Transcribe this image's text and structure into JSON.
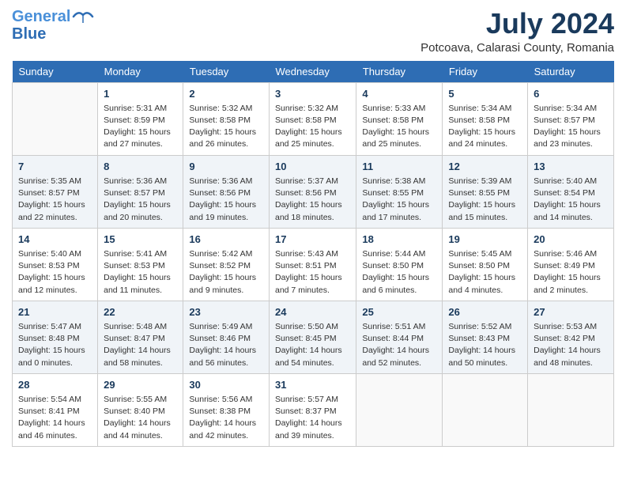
{
  "header": {
    "logo_line1": "General",
    "logo_line2": "Blue",
    "month_year": "July 2024",
    "location": "Potcoava, Calarasi County, Romania"
  },
  "days_of_week": [
    "Sunday",
    "Monday",
    "Tuesday",
    "Wednesday",
    "Thursday",
    "Friday",
    "Saturday"
  ],
  "weeks": [
    [
      {
        "day": "",
        "info": ""
      },
      {
        "day": "1",
        "info": "Sunrise: 5:31 AM\nSunset: 8:59 PM\nDaylight: 15 hours\nand 27 minutes."
      },
      {
        "day": "2",
        "info": "Sunrise: 5:32 AM\nSunset: 8:58 PM\nDaylight: 15 hours\nand 26 minutes."
      },
      {
        "day": "3",
        "info": "Sunrise: 5:32 AM\nSunset: 8:58 PM\nDaylight: 15 hours\nand 25 minutes."
      },
      {
        "day": "4",
        "info": "Sunrise: 5:33 AM\nSunset: 8:58 PM\nDaylight: 15 hours\nand 25 minutes."
      },
      {
        "day": "5",
        "info": "Sunrise: 5:34 AM\nSunset: 8:58 PM\nDaylight: 15 hours\nand 24 minutes."
      },
      {
        "day": "6",
        "info": "Sunrise: 5:34 AM\nSunset: 8:57 PM\nDaylight: 15 hours\nand 23 minutes."
      }
    ],
    [
      {
        "day": "7",
        "info": "Sunrise: 5:35 AM\nSunset: 8:57 PM\nDaylight: 15 hours\nand 22 minutes."
      },
      {
        "day": "8",
        "info": "Sunrise: 5:36 AM\nSunset: 8:57 PM\nDaylight: 15 hours\nand 20 minutes."
      },
      {
        "day": "9",
        "info": "Sunrise: 5:36 AM\nSunset: 8:56 PM\nDaylight: 15 hours\nand 19 minutes."
      },
      {
        "day": "10",
        "info": "Sunrise: 5:37 AM\nSunset: 8:56 PM\nDaylight: 15 hours\nand 18 minutes."
      },
      {
        "day": "11",
        "info": "Sunrise: 5:38 AM\nSunset: 8:55 PM\nDaylight: 15 hours\nand 17 minutes."
      },
      {
        "day": "12",
        "info": "Sunrise: 5:39 AM\nSunset: 8:55 PM\nDaylight: 15 hours\nand 15 minutes."
      },
      {
        "day": "13",
        "info": "Sunrise: 5:40 AM\nSunset: 8:54 PM\nDaylight: 15 hours\nand 14 minutes."
      }
    ],
    [
      {
        "day": "14",
        "info": "Sunrise: 5:40 AM\nSunset: 8:53 PM\nDaylight: 15 hours\nand 12 minutes."
      },
      {
        "day": "15",
        "info": "Sunrise: 5:41 AM\nSunset: 8:53 PM\nDaylight: 15 hours\nand 11 minutes."
      },
      {
        "day": "16",
        "info": "Sunrise: 5:42 AM\nSunset: 8:52 PM\nDaylight: 15 hours\nand 9 minutes."
      },
      {
        "day": "17",
        "info": "Sunrise: 5:43 AM\nSunset: 8:51 PM\nDaylight: 15 hours\nand 7 minutes."
      },
      {
        "day": "18",
        "info": "Sunrise: 5:44 AM\nSunset: 8:50 PM\nDaylight: 15 hours\nand 6 minutes."
      },
      {
        "day": "19",
        "info": "Sunrise: 5:45 AM\nSunset: 8:50 PM\nDaylight: 15 hours\nand 4 minutes."
      },
      {
        "day": "20",
        "info": "Sunrise: 5:46 AM\nSunset: 8:49 PM\nDaylight: 15 hours\nand 2 minutes."
      }
    ],
    [
      {
        "day": "21",
        "info": "Sunrise: 5:47 AM\nSunset: 8:48 PM\nDaylight: 15 hours\nand 0 minutes."
      },
      {
        "day": "22",
        "info": "Sunrise: 5:48 AM\nSunset: 8:47 PM\nDaylight: 14 hours\nand 58 minutes."
      },
      {
        "day": "23",
        "info": "Sunrise: 5:49 AM\nSunset: 8:46 PM\nDaylight: 14 hours\nand 56 minutes."
      },
      {
        "day": "24",
        "info": "Sunrise: 5:50 AM\nSunset: 8:45 PM\nDaylight: 14 hours\nand 54 minutes."
      },
      {
        "day": "25",
        "info": "Sunrise: 5:51 AM\nSunset: 8:44 PM\nDaylight: 14 hours\nand 52 minutes."
      },
      {
        "day": "26",
        "info": "Sunrise: 5:52 AM\nSunset: 8:43 PM\nDaylight: 14 hours\nand 50 minutes."
      },
      {
        "day": "27",
        "info": "Sunrise: 5:53 AM\nSunset: 8:42 PM\nDaylight: 14 hours\nand 48 minutes."
      }
    ],
    [
      {
        "day": "28",
        "info": "Sunrise: 5:54 AM\nSunset: 8:41 PM\nDaylight: 14 hours\nand 46 minutes."
      },
      {
        "day": "29",
        "info": "Sunrise: 5:55 AM\nSunset: 8:40 PM\nDaylight: 14 hours\nand 44 minutes."
      },
      {
        "day": "30",
        "info": "Sunrise: 5:56 AM\nSunset: 8:38 PM\nDaylight: 14 hours\nand 42 minutes."
      },
      {
        "day": "31",
        "info": "Sunrise: 5:57 AM\nSunset: 8:37 PM\nDaylight: 14 hours\nand 39 minutes."
      },
      {
        "day": "",
        "info": ""
      },
      {
        "day": "",
        "info": ""
      },
      {
        "day": "",
        "info": ""
      }
    ]
  ]
}
